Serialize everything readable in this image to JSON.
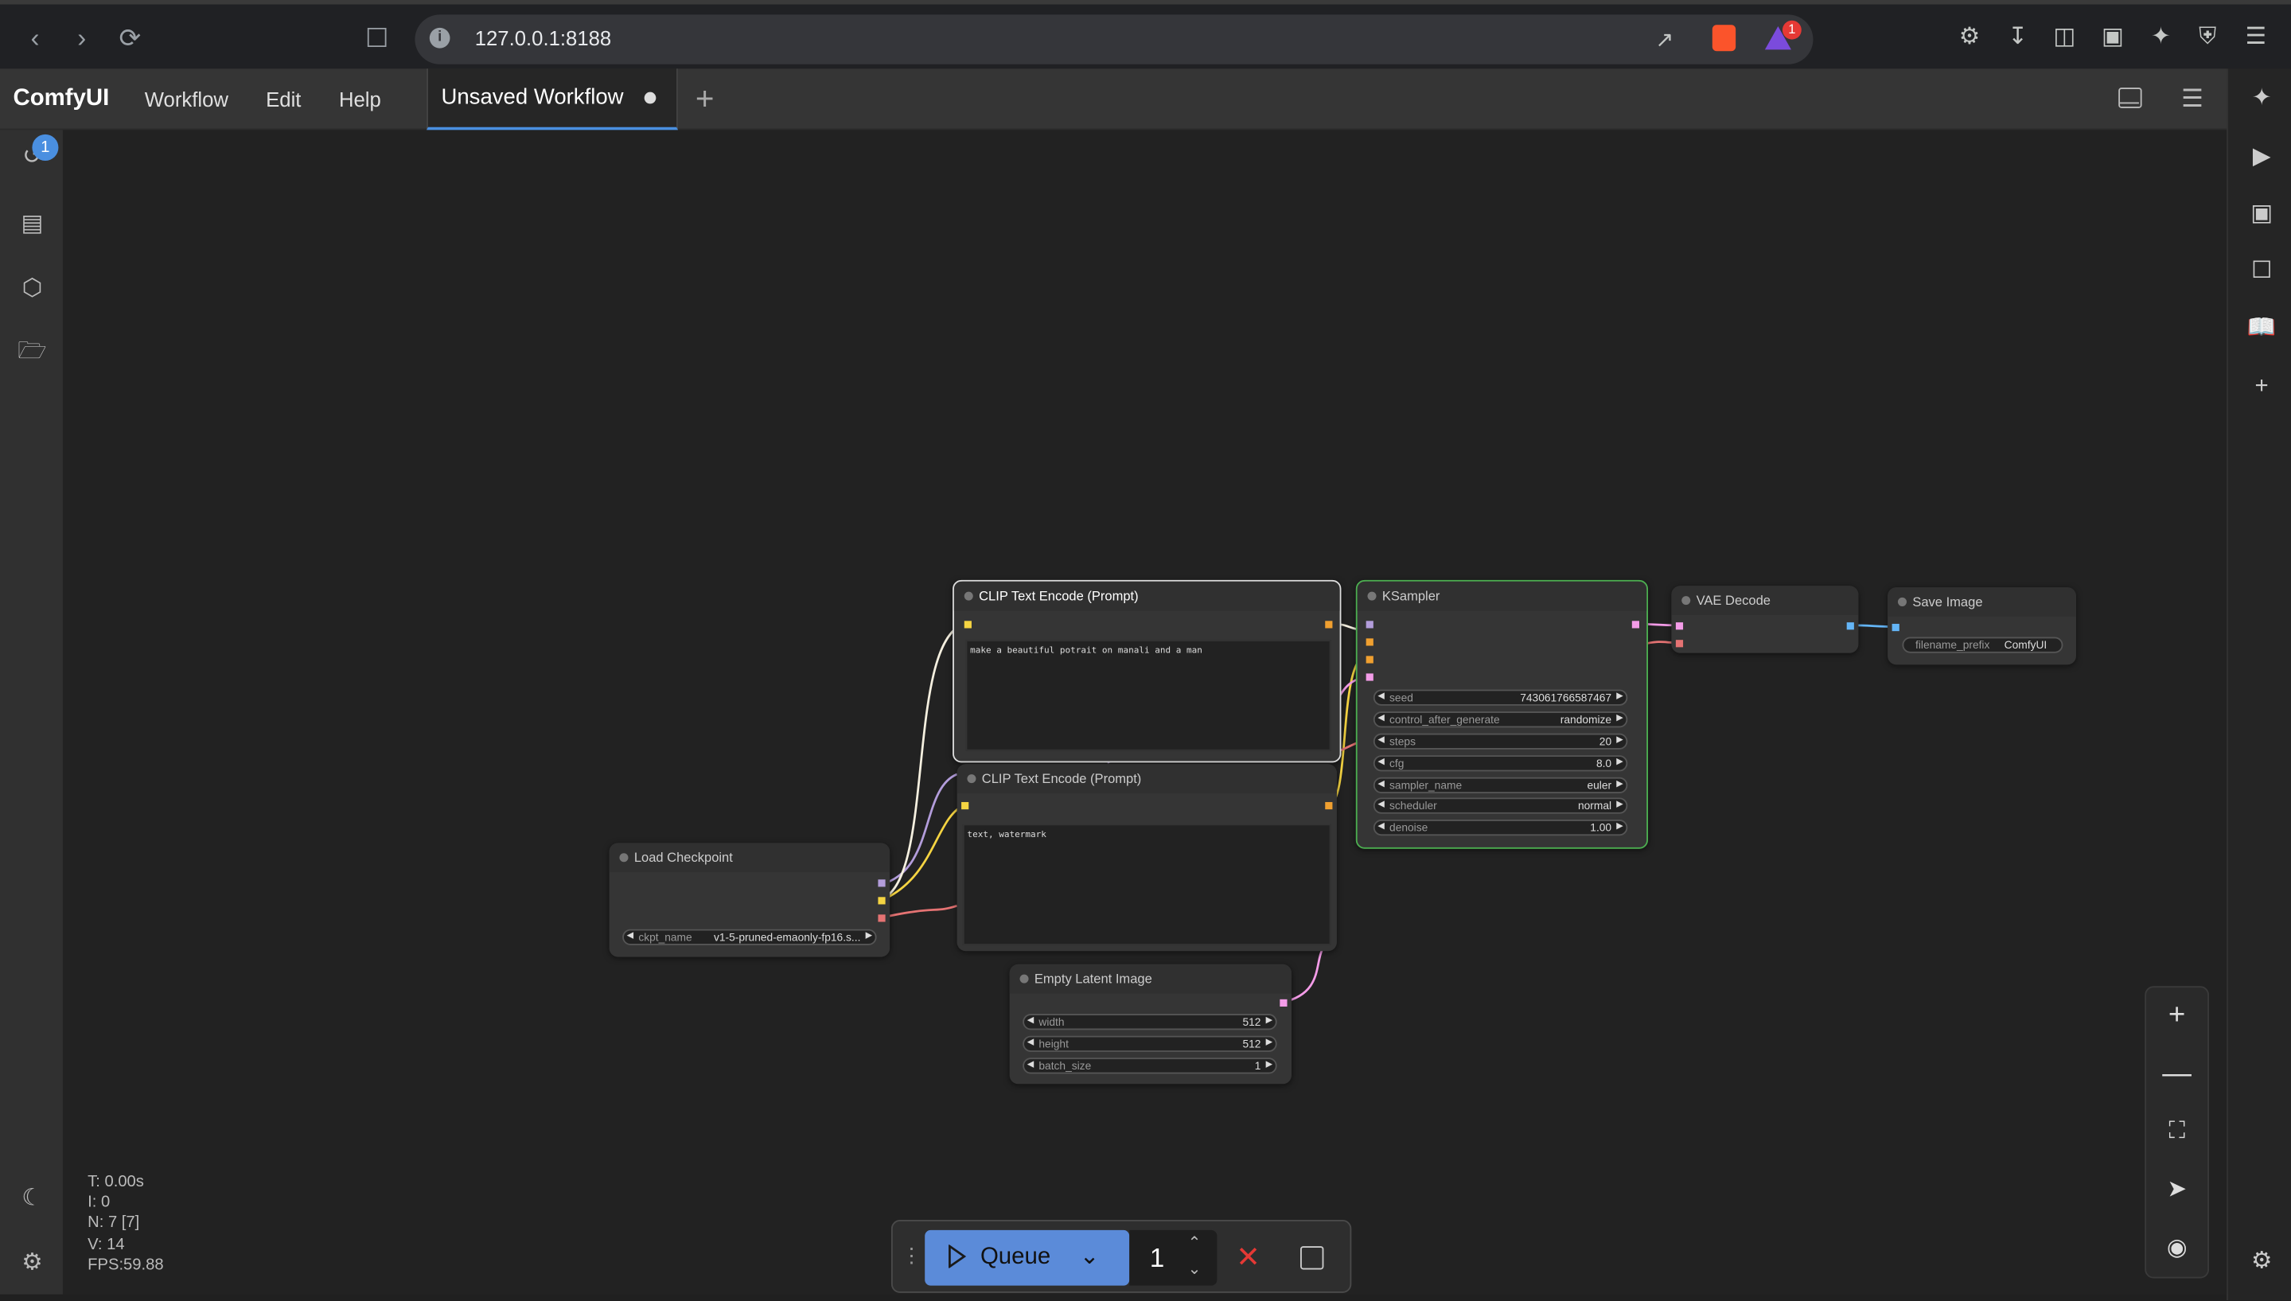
{
  "browser": {
    "url": "127.0.0.1:8188",
    "brave_badge": "1"
  },
  "menubar": {
    "logo": "ComfyUI",
    "items": [
      "Workflow",
      "Edit",
      "Help"
    ],
    "tab_label": "Unsaved Workflow"
  },
  "sidebar": {
    "queue_badge": "1"
  },
  "nodes": {
    "clip_pos": {
      "title": "CLIP Text Encode (Prompt)",
      "text": "make a beautiful potrait on manali and a man"
    },
    "clip_neg": {
      "title": "CLIP Text Encode (Prompt)",
      "text": "text, watermark"
    },
    "ksampler": {
      "title": "KSampler",
      "widgets": [
        {
          "name": "seed",
          "value": "743061766587467"
        },
        {
          "name": "control_after_generate",
          "value": "randomize"
        },
        {
          "name": "steps",
          "value": "20"
        },
        {
          "name": "cfg",
          "value": "8.0"
        },
        {
          "name": "sampler_name",
          "value": "euler"
        },
        {
          "name": "scheduler",
          "value": "normal"
        },
        {
          "name": "denoise",
          "value": "1.00"
        }
      ]
    },
    "vae_decode": {
      "title": "VAE Decode"
    },
    "save_image": {
      "title": "Save Image",
      "widget": {
        "name": "filename_prefix",
        "value": "ComfyUI"
      }
    },
    "load_checkpoint": {
      "title": "Load Checkpoint",
      "widget": {
        "name": "ckpt_name",
        "value": "v1-5-pruned-emaonly-fp16.s..."
      }
    },
    "empty_latent": {
      "title": "Empty Latent Image",
      "widgets": [
        {
          "name": "width",
          "value": "512"
        },
        {
          "name": "height",
          "value": "512"
        },
        {
          "name": "batch_size",
          "value": "1"
        }
      ]
    }
  },
  "stats": {
    "t": "T: 0.00s",
    "i": "I: 0",
    "n": "N: 7 [7]",
    "v": "V: 14",
    "fps": "FPS:59.88"
  },
  "queue": {
    "label": "Queue",
    "count": "1"
  },
  "colors": {
    "accent": "#5b8bd9",
    "ksampler_border": "#4caf50",
    "clip_wire": "#f5d442",
    "model_wire": "#b39ddb",
    "vae_wire": "#e57373",
    "latent_wire": "#f49ce8",
    "image_wire": "#64b5f6"
  }
}
